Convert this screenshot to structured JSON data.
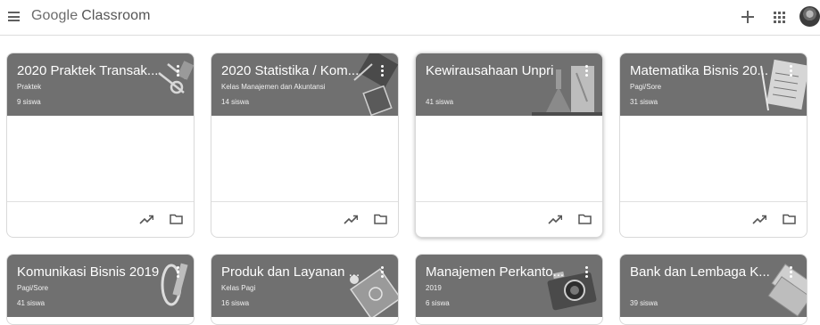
{
  "app": {
    "brand_google": "Google",
    "brand_product": "Classroom",
    "icons": {
      "menu": "menu-icon",
      "add": "plus-icon",
      "apps": "apps-grid-icon",
      "account": "avatar"
    }
  },
  "classes": [
    {
      "title": "2020 Praktek Transak...",
      "section": "Praktek",
      "students": "9 siswa"
    },
    {
      "title": "2020 Statistika / Kom...",
      "section": "Kelas Manajemen dan Akuntansi",
      "students": "14 siswa"
    },
    {
      "title": "Kewirausahaan Unpri",
      "section": "",
      "students": "41 siswa"
    },
    {
      "title": "Matematika Bisnis 20...",
      "section": "Pagi/Sore",
      "students": "31 siswa"
    },
    {
      "title": "Komunikasi Bisnis 2019",
      "section": "Pagi/Sore",
      "students": "41 siswa"
    },
    {
      "title": "Produk dan Layanan ...",
      "section": "Kelas Pagi",
      "students": "16 siswa"
    },
    {
      "title": "Manajemen Perkanto...",
      "section": "2019",
      "students": "6 siswa"
    },
    {
      "title": "Bank dan Lembaga K...",
      "section": "",
      "students": "39 siswa"
    }
  ],
  "colors": {
    "card_header": "#707070",
    "topbar_border": "#dcdcdc"
  }
}
